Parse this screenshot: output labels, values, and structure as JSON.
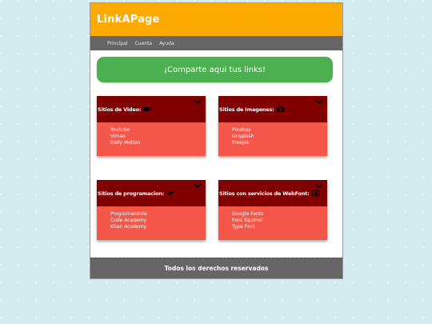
{
  "header": {
    "logo": "LinkAPage"
  },
  "nav": {
    "items": [
      "Principal",
      "Cuenta",
      "Ayuda"
    ]
  },
  "banner": {
    "text": "¡Comparte aqui tus links!"
  },
  "cards": [
    {
      "title": "Sitios de Video:",
      "icon": "video-camera-icon",
      "links": [
        "Youtube",
        "Vimeo",
        "Daily Motion"
      ]
    },
    {
      "title": "Sitios de Imagenes:",
      "icon": "camera-icon",
      "links": [
        "Pixabay",
        "Unsplash",
        "Freepik"
      ]
    },
    {
      "title": "Sitios de programacion:",
      "icon": "book-icon",
      "links": [
        "Programandola",
        "Code Academy",
        "Khan Academy"
      ]
    },
    {
      "title": "Sitios con servicios de WebFont:",
      "icon": "font-icon",
      "links": [
        "Google Fonts",
        "Font Squirrel",
        "Type Font"
      ]
    }
  ],
  "footer": {
    "text": "Todos los derechos reservados"
  },
  "colors": {
    "header": "#fdaa00",
    "nav": "#666666",
    "banner": "#4caf50",
    "card_head": "#800000",
    "card_body": "#f4574a",
    "footer": "#666666"
  }
}
